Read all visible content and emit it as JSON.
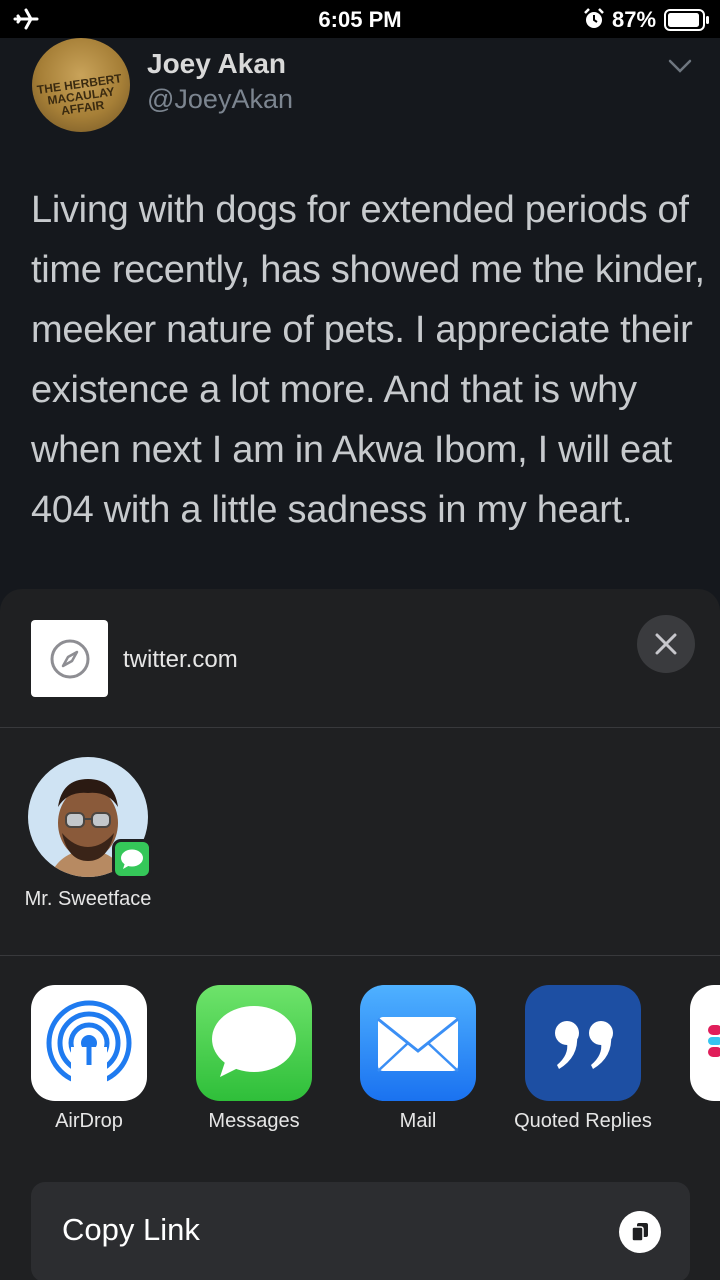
{
  "status_bar": {
    "time": "6:05 PM",
    "battery": "87%",
    "icons": [
      "airplane-icon",
      "alarm-icon",
      "battery-icon"
    ]
  },
  "tweet": {
    "author_name": "Joey Akan",
    "author_handle": "@JoeyAkan",
    "avatar_text": "THE HERBERT MACAULAY AFFAIR",
    "body": "Living with dogs for extended periods of time recently, has showed me the kinder, meeker nature of pets. I appreciate their existence a lot more. And that is why when next I am in Akwa Ibom, I will eat 404 with a little sadness in my heart."
  },
  "share_sheet": {
    "url": "twitter.com",
    "contact": {
      "name": "Mr. Sweetface"
    },
    "apps": [
      {
        "label": "AirDrop",
        "icon": "airdrop-icon"
      },
      {
        "label": "Messages",
        "icon": "messages-icon"
      },
      {
        "label": "Mail",
        "icon": "mail-icon"
      },
      {
        "label": "Quoted Replies",
        "icon": "quoted-replies-icon"
      },
      {
        "label": "",
        "icon": "slack-icon"
      }
    ],
    "copy_link_label": "Copy Link"
  },
  "colors": {
    "background": "#15181d",
    "sheet": "#1f2022",
    "accent_green": "#35c759"
  }
}
